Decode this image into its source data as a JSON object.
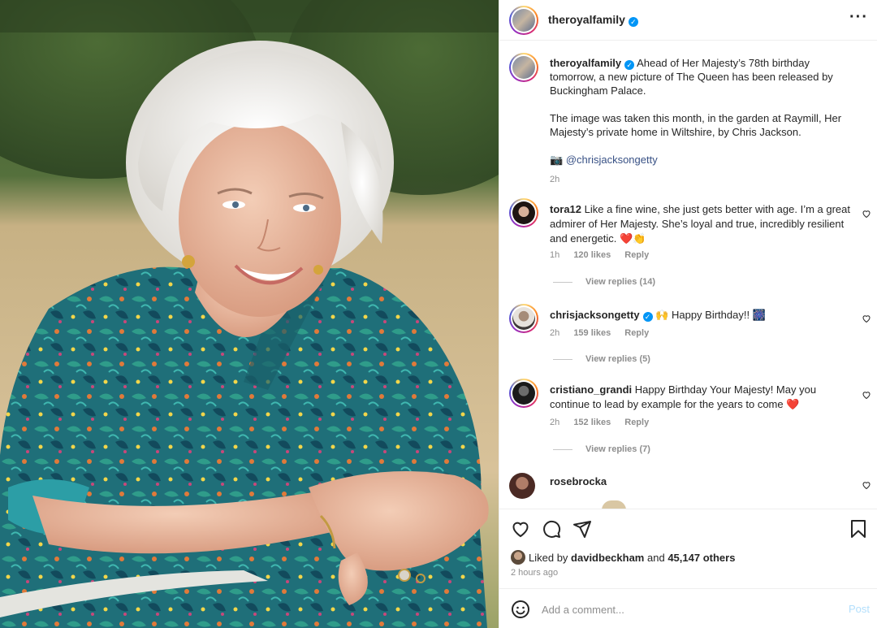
{
  "header": {
    "username": "theroyalfamily",
    "verified_mark": "✓",
    "more_label": "···"
  },
  "caption": {
    "username": "theroyalfamily",
    "verified_mark": "✓",
    "paragraph1": "Ahead of Her Majesty’s 78th birthday tomorrow, a new picture of The Queen has been released by Buckingham Palace.",
    "paragraph2": "The image was taken this month, in the garden at Raymill, Her Majesty’s private home in Wiltshire, by Chris Jackson.",
    "camera_icon": "📷",
    "mention": "@chrisjacksongetty",
    "time": "2h"
  },
  "comments": [
    {
      "username": "tora12",
      "text": "Like a fine wine, she just gets better with age. I’m a great admirer of Her Majesty. She’s loyal and true, incredibly resilient and energetic. ❤️👏",
      "time": "1h",
      "likes": "120 likes",
      "reply": "Reply",
      "view_replies": "View replies (14)",
      "verified": false
    },
    {
      "username": "chrisjacksongetty",
      "text": "🙌 Happy Birthday!! 🎆",
      "time": "2h",
      "likes": "159 likes",
      "reply": "Reply",
      "view_replies": "View replies (5)",
      "verified": true
    },
    {
      "username": "cristiano_grandi",
      "text": "Happy Birthday Your Majesty! May you continue to lead by example for the years to come ❤️",
      "time": "2h",
      "likes": "152 likes",
      "reply": "Reply",
      "view_replies": "View replies (7)",
      "verified": false
    },
    {
      "username": "rosebrocka",
      "text": "",
      "verified": false
    }
  ],
  "actions": {
    "liked_by_prefix": "Liked by",
    "liked_by_user": "davidbeckham",
    "liked_by_and": "and",
    "liked_by_others": "45,147 others",
    "posted_time": "2 hours ago"
  },
  "add_comment": {
    "placeholder": "Add a comment...",
    "post_label": "Post"
  },
  "icons": {
    "like": "heart-icon",
    "comment": "comment-icon",
    "share": "paper-plane-icon",
    "save": "bookmark-icon",
    "emoji": "smiley-icon"
  },
  "colors": {
    "link": "#385185",
    "verified": "#0095f6",
    "muted": "#8e8e8e",
    "post_disabled": "#b2dffc",
    "heart_red": "#ed4956"
  }
}
